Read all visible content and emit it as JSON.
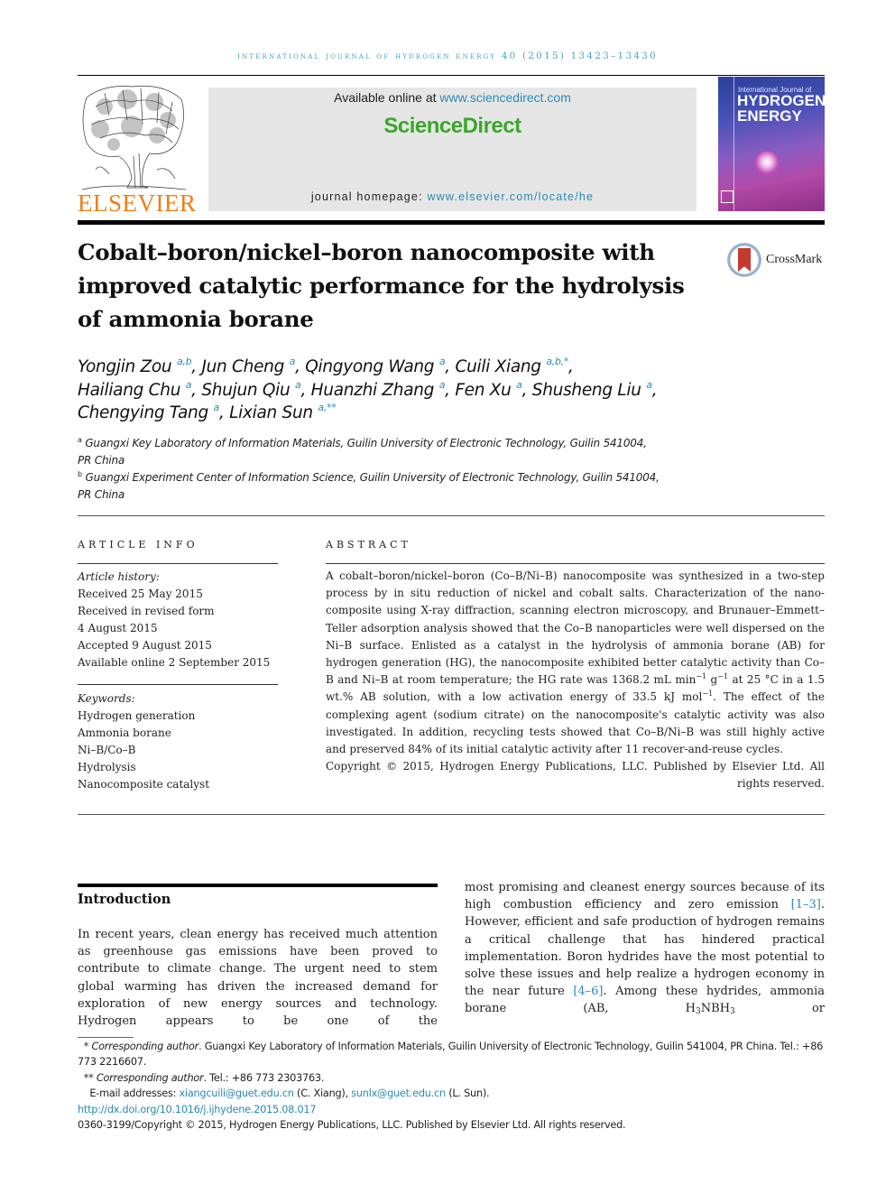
{
  "header": {
    "running_head": "INTERNATIONAL JOURNAL OF HYDROGEN ENERGY 40 (2015) 13423–13430",
    "publisher_logo": "ELSEVIER",
    "available_online_prefix": "Available online at ",
    "available_online_link": "www.sciencedirect.com",
    "platform_brand": "ScienceDirect",
    "homepage_prefix": "journal homepage: ",
    "homepage_link": "www.elsevier.com/locate/he",
    "cover": {
      "line1": "International Journal of",
      "line2": "HYDROGEN",
      "line3": "ENERGY"
    },
    "colors": {
      "link": "#2a8ab8",
      "elsevier_orange": "#f07e12",
      "sciencedirect_green": "#3ca62b"
    }
  },
  "article": {
    "title_lines": [
      "Cobalt–boron/nickel–boron nanocomposite with",
      "improved catalytic performance for the hydrolysis",
      "of ammonia borane"
    ],
    "crossmark_label": "CrossMark",
    "authors": [
      {
        "name": "Yongjin Zou",
        "marks": "a,b"
      },
      {
        "name": "Jun Cheng",
        "marks": "a"
      },
      {
        "name": "Qingyong Wang",
        "marks": "a"
      },
      {
        "name": "Cuili Xiang",
        "marks": "a,b,*"
      },
      {
        "name": "Hailiang Chu",
        "marks": "a"
      },
      {
        "name": "Shujun Qiu",
        "marks": "a"
      },
      {
        "name": "Huanzhi Zhang",
        "marks": "a"
      },
      {
        "name": "Fen Xu",
        "marks": "a"
      },
      {
        "name": "Shusheng Liu",
        "marks": "a"
      },
      {
        "name": "Chengying Tang",
        "marks": "a"
      },
      {
        "name": "Lixian Sun",
        "marks": "a,**"
      }
    ],
    "affiliations": [
      {
        "mark": "a",
        "line1": "Guangxi Key Laboratory of Information Materials, Guilin University of Electronic Technology, Guilin 541004,",
        "line2": "PR China"
      },
      {
        "mark": "b",
        "line1": "Guangxi Experiment Center of Information Science, Guilin University of Electronic Technology, Guilin 541004,",
        "line2": "PR China"
      }
    ]
  },
  "article_info": {
    "heading": "ARTICLE INFO",
    "history_label": "Article history:",
    "history": [
      "Received 25 May 2015",
      "Received in revised form",
      "4 August 2015",
      "Accepted 9 August 2015",
      "Available online 2 September 2015"
    ],
    "keywords_label": "Keywords:",
    "keywords": [
      "Hydrogen generation",
      "Ammonia borane",
      "Ni–B/Co–B",
      "Hydrolysis",
      "Nanocomposite catalyst"
    ]
  },
  "abstract": {
    "heading": "ABSTRACT",
    "part1": "A cobalt–boron/nickel–boron (Co–B/Ni–B) nanocomposite was synthesized in a two-step process by in situ reduction of nickel and cobalt salts. Characterization of the nano-composite using X-ray diffraction, scanning electron microscopy, and Brunauer–Emmett–Teller adsorption analysis showed that the Co–B nanoparticles were well dispersed on the Ni–B surface. Enlisted as a catalyst in the hydrolysis of ammonia borane (AB) for hydrogen generation (HG), the nanocomposite exhibited better catalytic activity than Co–B and Ni–B at room temperature; the HG rate was 1368.2 mL min",
    "sup1": "−1",
    "part2": " g",
    "sup2": "−1",
    "part3": " at 25 °C in a 1.5 wt.% AB solution, with a low activation energy of 33.5 kJ mol",
    "sup3": "−1",
    "part4": ". The effect of the complexing agent (sodium citrate) on the nanocomposite's catalytic activity was also investigated. In addition, recycling tests showed that Co–B/Ni–B was still highly active and preserved 84% of its initial catalytic activity after 11 recover-and-reuse cycles.",
    "copyright": "Copyright © 2015, Hydrogen Energy Publications, LLC. Published by Elsevier Ltd. All rights reserved."
  },
  "introduction": {
    "heading": "Introduction",
    "left_column": "In recent years, clean energy has received much attention as greenhouse gas emissions have been proved to contribute to climate change. The urgent need to stem global warming has driven the increased demand for exploration of new energy sources and technology. Hydrogen appears to be one of the",
    "right_part1": "most promising and cleanest energy sources because of its high combustion efficiency and zero emission ",
    "ref1": "[1–3]",
    "right_part2": ". However, efficient and safe production of hydrogen remains a critical challenge that has hindered practical implementation. Boron hydrides have the most potential to solve these issues and help realize a hydrogen economy in the near future ",
    "ref2": "[4–6]",
    "right_part3": ". Among these hydrides, ammonia borane (AB, H",
    "sub1": "3",
    "right_part4": "NBH",
    "sub2": "3",
    "right_part5": " or"
  },
  "footnotes": {
    "fn1_mark": "* ",
    "fn1_label": "Corresponding author",
    "fn1_text": ". Guangxi Key Laboratory of Information Materials, Guilin University of Electronic Technology, Guilin 541004, PR China. Tel.: +86 773 2216607.",
    "fn2_mark": "** ",
    "fn2_label": "Corresponding author",
    "fn2_text": ". Tel.: +86 773 2303763.",
    "email_prefix": "E-mail addresses: ",
    "email1": "xiangcuili@guet.edu.cn",
    "email1_owner": " (C. Xiang), ",
    "email2": "sunlx@guet.edu.cn",
    "email2_owner": " (L. Sun).",
    "doi": "http://dx.doi.org/10.1016/j.ijhydene.2015.08.017",
    "issn_copyright": "0360-3199/Copyright © 2015, Hydrogen Energy Publications, LLC. Published by Elsevier Ltd. All rights reserved."
  }
}
